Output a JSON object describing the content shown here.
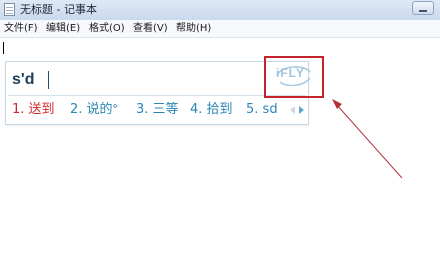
{
  "window": {
    "title": "无标题 - 记事本"
  },
  "menu": {
    "items": [
      {
        "label": "文件(F)"
      },
      {
        "label": "编辑(E)"
      },
      {
        "label": "格式(O)"
      },
      {
        "label": "查看(V)"
      },
      {
        "label": "帮助(H)"
      }
    ]
  },
  "ime": {
    "composition": "s'd",
    "candidates": [
      {
        "index": "1.",
        "text": "送到",
        "selected": true
      },
      {
        "index": "2.",
        "text": "说的ᐤ",
        "selected": false
      },
      {
        "index": "3.",
        "text": "三等",
        "selected": false
      },
      {
        "index": "4.",
        "text": "拾到",
        "selected": false
      },
      {
        "index": "5.",
        "text": "sd",
        "selected": false
      }
    ],
    "logo_text": "iFLY"
  },
  "icons": {
    "app": "notepad-icon",
    "minimize": "minimize-icon",
    "page_prev": "chevron-left-icon",
    "page_next": "chevron-right-icon"
  },
  "colors": {
    "annotation": "#c4232b",
    "candidate_selected": "#d2282d",
    "candidate": "#2a85b5"
  }
}
